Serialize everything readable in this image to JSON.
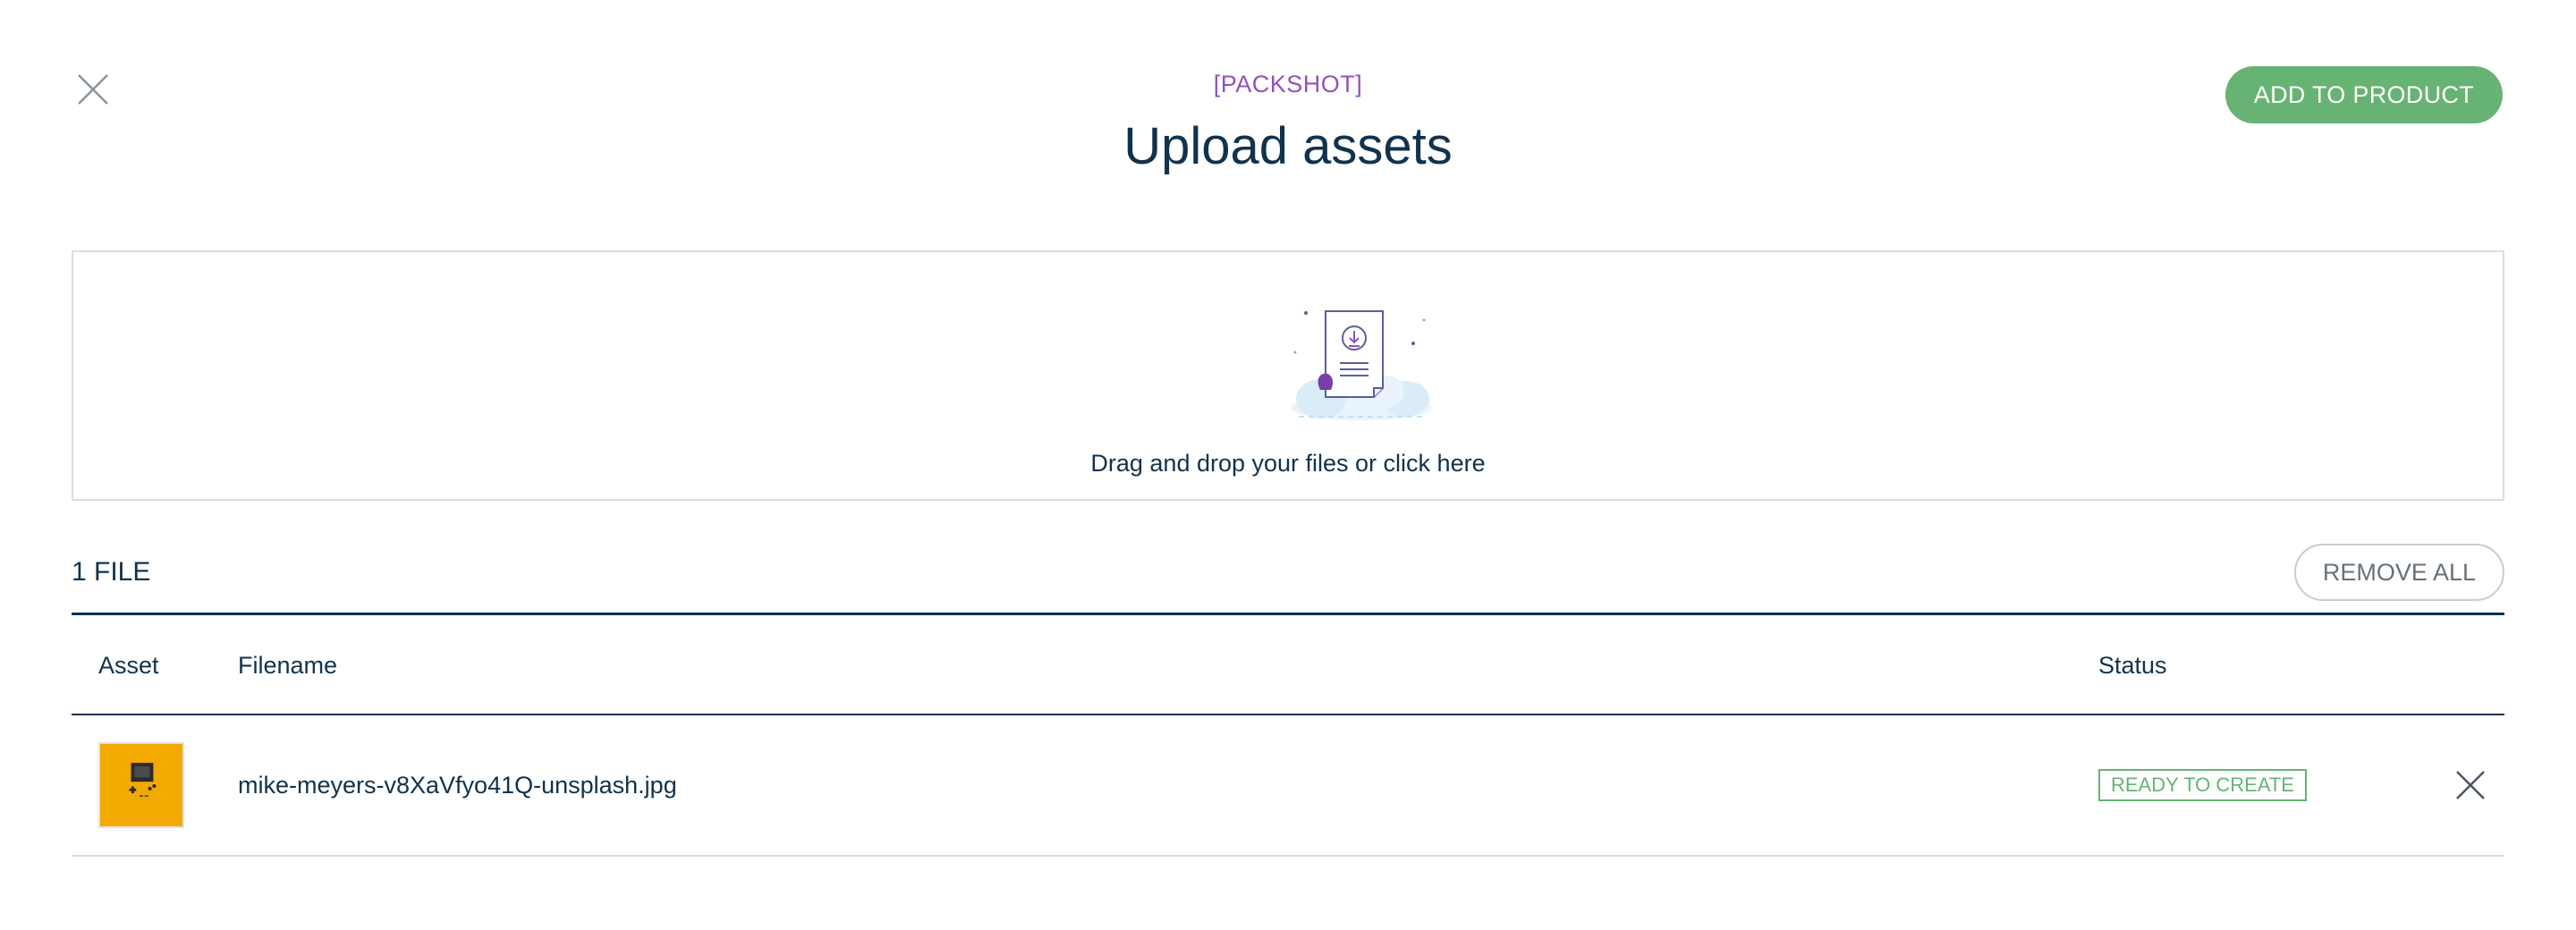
{
  "header": {
    "context_label": "[PACKSHOT]",
    "title": "Upload assets",
    "close_icon": "close-icon",
    "add_button_label": "ADD TO PRODUCT"
  },
  "dropzone": {
    "illustration_icon": "file-download-illustration",
    "instruction": "Drag and drop your files or click here"
  },
  "files": {
    "count_label": "1 FILE",
    "remove_all_label": "REMOVE ALL",
    "columns": [
      "Asset",
      "Filename",
      "Status"
    ],
    "rows": [
      {
        "filename": "mike-meyers-v8XaVfyo41Q-unsplash.jpg",
        "status": "READY TO CREATE",
        "remove_icon": "close-icon"
      }
    ]
  },
  "colors": {
    "primary_text": "#11324d",
    "accent_purple": "#9452ba",
    "success_green": "#67b373",
    "border_grey": "#d9dde2",
    "thumbnail_bg": "#f2a900"
  }
}
